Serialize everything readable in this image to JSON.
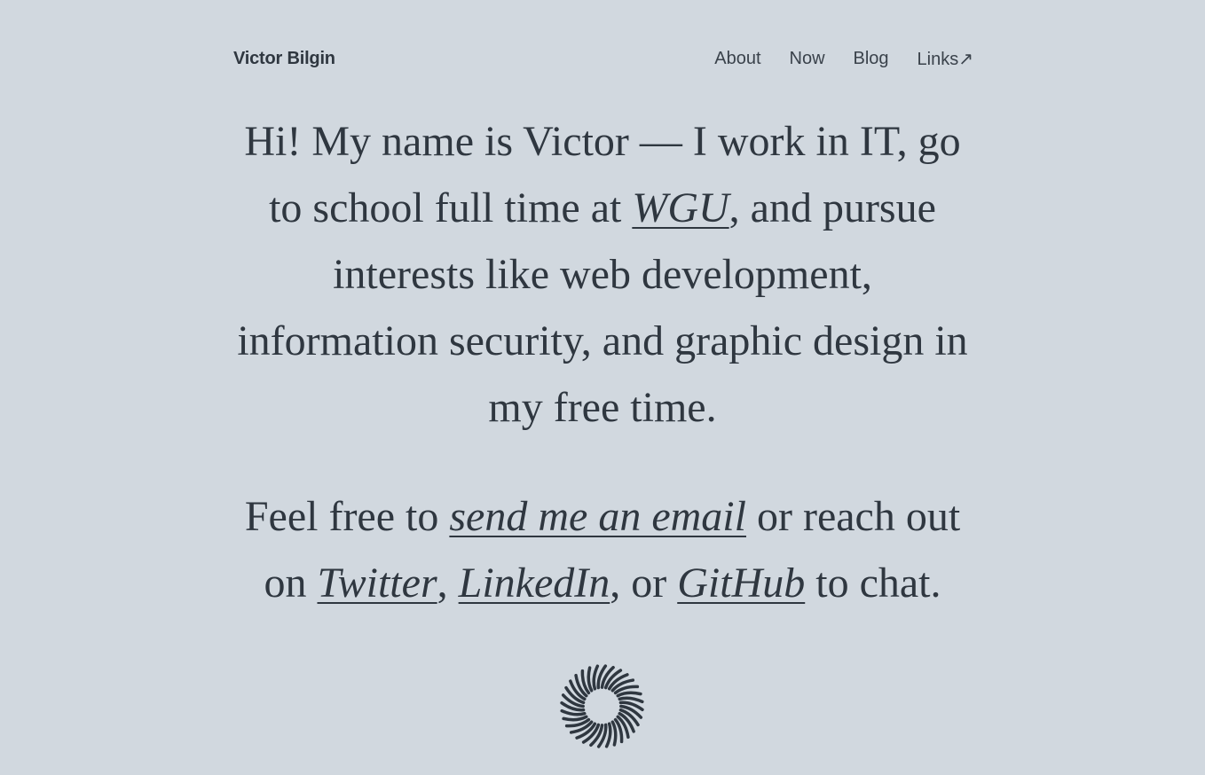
{
  "header": {
    "site_name": "Victor Bilgin",
    "nav": [
      {
        "label": "About"
      },
      {
        "label": "Now"
      },
      {
        "label": "Blog"
      },
      {
        "label": "Links↗"
      }
    ]
  },
  "intro": {
    "part1": "Hi! My name is Victor — I work in IT, go to school full time at ",
    "wgu_link": "WGU",
    "part2": ", and pursue interests like web development, information security, and graphic design in my free time."
  },
  "contact": {
    "part1": "Feel free to ",
    "email_link": "send me an email",
    "part2": " or reach out on ",
    "twitter_link": "Twitter",
    "sep1": ", ",
    "linkedin_link": "LinkedIn",
    "sep2": ", or ",
    "github_link": "GitHub",
    "part3": " to chat."
  },
  "footer": {
    "logo_icon": "sunburst-icon"
  },
  "colors": {
    "background": "#d1d8df",
    "text": "#2f3740"
  }
}
